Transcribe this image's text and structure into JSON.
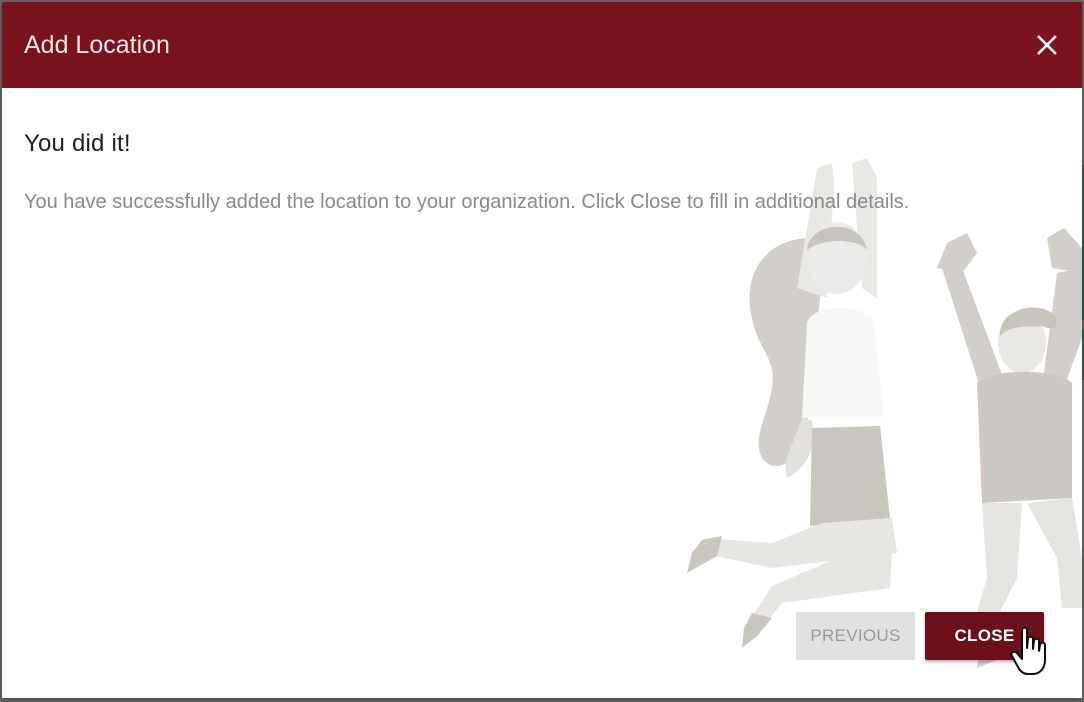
{
  "dialog": {
    "title": "Add Location",
    "close_icon": "close-icon",
    "header_color": "#79121d"
  },
  "body": {
    "heading": "You did it!",
    "message": "You have successfully added the location to your organization. Click Close to fill in additional details.",
    "illustration": "celebrating-people-illustration"
  },
  "buttons": {
    "previous_label": "PREVIOUS",
    "close_label": "CLOSE",
    "primary_color": "#6b0f18"
  },
  "cursor": "hand-pointer-cursor"
}
